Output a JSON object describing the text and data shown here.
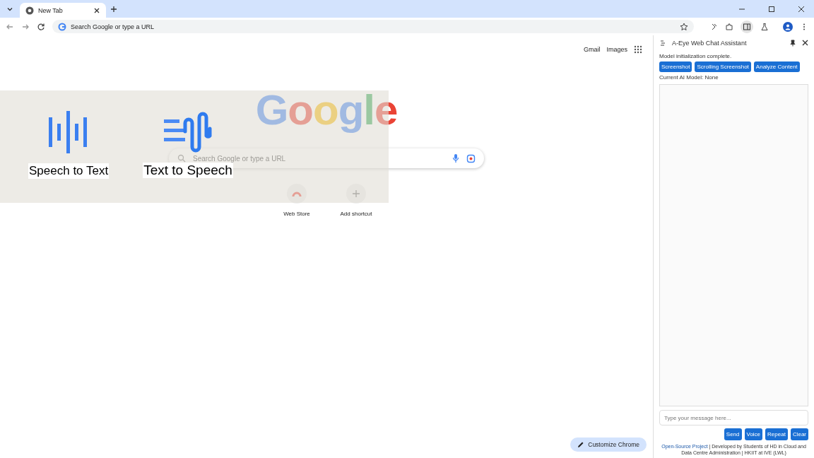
{
  "browser": {
    "tab": {
      "title": "New Tab",
      "selected": true
    },
    "address_placeholder": "Search Google or type a URL"
  },
  "new_tab_page": {
    "header_links": [
      "Gmail",
      "Images"
    ],
    "logo": "Google",
    "search_placeholder": "Search Google or type a URL",
    "shortcuts": [
      {
        "label": "Web Store",
        "kind": "store"
      },
      {
        "label": "Add shortcut",
        "kind": "add"
      }
    ],
    "customize_button": "Customize Chrome"
  },
  "overlay": {
    "features": [
      {
        "label": "Speech to Text",
        "kind": "stt"
      },
      {
        "label": "Text to Speech",
        "kind": "tts"
      }
    ]
  },
  "side_panel": {
    "title": "A-Eye Web Chat Assistant",
    "status": "Model initialization complete.",
    "action_buttons": [
      "Screenshot",
      "Scrolling Screenshot",
      "Analyze Content"
    ],
    "model_info": "Current AI Model: None",
    "message_placeholder": "Type your message here...",
    "chat_buttons": [
      "Send",
      "Voice",
      "Repeat",
      "Clear"
    ],
    "footer_link": "Open-Source Project",
    "footer_text": "| Developed by Students of HD in Cloud and Data Centre Administration | HKIIT at IVE (LWL)"
  }
}
